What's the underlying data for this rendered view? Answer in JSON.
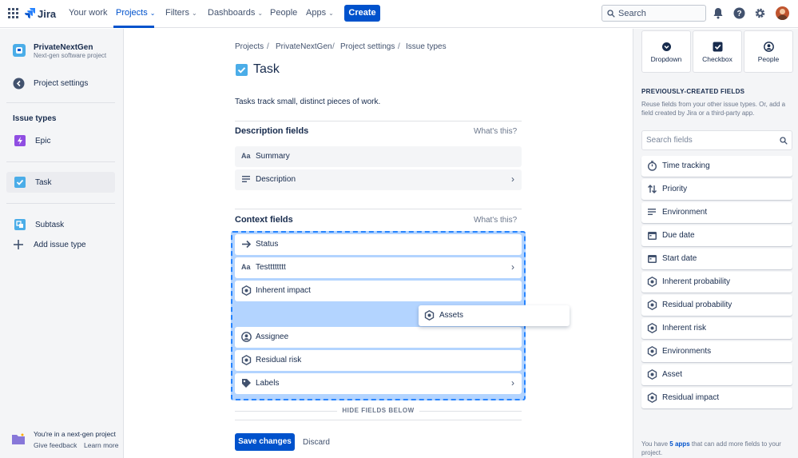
{
  "topnav": {
    "product": "Jira",
    "items": [
      {
        "label": "Your work",
        "dropdown": false
      },
      {
        "label": "Projects",
        "dropdown": true,
        "active": true
      },
      {
        "label": "Filters",
        "dropdown": true
      },
      {
        "label": "Dashboards",
        "dropdown": true
      },
      {
        "label": "People",
        "dropdown": false
      },
      {
        "label": "Apps",
        "dropdown": true
      }
    ],
    "create_label": "Create",
    "search_placeholder": "Search"
  },
  "sidebar": {
    "project_name": "PrivateNextGen",
    "project_type": "Next-gen software project",
    "back_label": "Project settings",
    "section_title": "Issue types",
    "issue_types": [
      {
        "label": "Epic",
        "icon": "epic-icon",
        "color": "#904ee2"
      },
      {
        "label": "Task",
        "icon": "task-icon",
        "color": "#4bade8",
        "selected": true
      },
      {
        "label": "Subtask",
        "icon": "subtask-icon",
        "color": "#4bade8"
      }
    ],
    "add_issue_type": "Add issue type",
    "footer_text": "You're in a next-gen project",
    "give_feedback": "Give feedback",
    "learn_more": "Learn more"
  },
  "breadcrumb": [
    "Projects",
    "PrivateNextGen",
    "Project settings",
    "Issue types"
  ],
  "main": {
    "title": "Task",
    "description": "Tasks track small, distinct pieces of work.",
    "description_section": {
      "title": "Description fields",
      "whats_this": "What's this?",
      "fields": [
        {
          "label": "Summary",
          "icon": "text-field-icon",
          "chevron": false
        },
        {
          "label": "Description",
          "icon": "paragraph-icon",
          "chevron": true
        }
      ]
    },
    "context_section": {
      "title": "Context fields",
      "whats_this": "What's this?",
      "fields_top": [
        {
          "label": "Status",
          "icon": "status-arrow-icon",
          "chevron": false
        },
        {
          "label": "Testttttttt",
          "icon": "text-field-icon",
          "chevron": true
        },
        {
          "label": "Inherent impact",
          "icon": "custom-field-icon",
          "chevron": false
        }
      ],
      "dragging_field": {
        "label": "Assets",
        "icon": "custom-field-icon"
      },
      "fields_bottom": [
        {
          "label": "Assignee",
          "icon": "person-icon",
          "chevron": false
        },
        {
          "label": "Residual risk",
          "icon": "custom-field-icon",
          "chevron": false
        },
        {
          "label": "Labels",
          "icon": "label-tag-icon",
          "chevron": true
        }
      ]
    },
    "hide_fields_below": "HIDE FIELDS BELOW",
    "save_label": "Save changes",
    "discard_label": "Discard"
  },
  "rpanel": {
    "tiles": [
      {
        "label": "Dropdown",
        "icon": "dropdown-icon"
      },
      {
        "label": "Checkbox",
        "icon": "checkbox-icon"
      },
      {
        "label": "People",
        "icon": "people-icon"
      }
    ],
    "prev_title": "PREVIOUSLY-CREATED FIELDS",
    "prev_desc": "Reuse fields from your other issue types. Or, add a field created by Jira or a third-party app.",
    "search_placeholder": "Search fields",
    "fields": [
      {
        "label": "Time tracking",
        "icon": "stopwatch-icon"
      },
      {
        "label": "Priority",
        "icon": "priority-arrows-icon"
      },
      {
        "label": "Environment",
        "icon": "paragraph-icon"
      },
      {
        "label": "Due date",
        "icon": "calendar-icon"
      },
      {
        "label": "Start date",
        "icon": "calendar-icon"
      },
      {
        "label": "Inherent probability",
        "icon": "custom-field-icon"
      },
      {
        "label": "Residual probability",
        "icon": "custom-field-icon"
      },
      {
        "label": "Inherent risk",
        "icon": "custom-field-icon"
      },
      {
        "label": "Environments",
        "icon": "custom-field-icon"
      },
      {
        "label": "Asset",
        "icon": "custom-field-icon"
      },
      {
        "label": "Residual impact",
        "icon": "custom-field-icon"
      }
    ],
    "footer_prefix": "You have ",
    "footer_link": "5 apps",
    "footer_suffix": " that can add more fields to your project."
  },
  "colors": {
    "brand": "#0052cc",
    "dropzone": "#b3d4ff",
    "dropzone_border": "#2684ff"
  }
}
